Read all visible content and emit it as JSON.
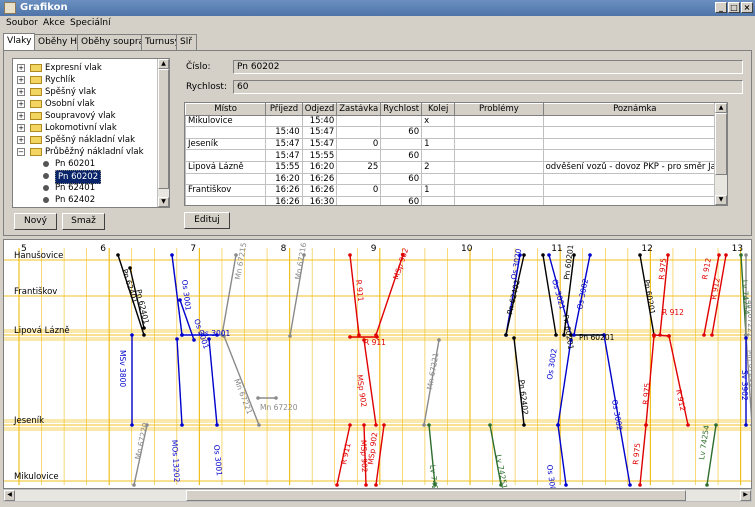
{
  "window": {
    "title": "Grafikon",
    "min": "_",
    "max": "□",
    "close": "×"
  },
  "menu": [
    "Soubor",
    "Akce",
    "Speciální"
  ],
  "tabs": [
    "Vlaky",
    "Oběhy HV",
    "Oběhy souprav",
    "Turnusy",
    "Slř"
  ],
  "tree": {
    "categories": [
      "Expresní vlak",
      "Rychlík",
      "Spěšný vlak",
      "Osobní vlak",
      "Soupravový vlak",
      "Lokomotivní vlak",
      "Spěšný nákladní vlak",
      "Průběžný nákladní vlak"
    ],
    "children": [
      "Pn 60201",
      "Pn 60202",
      "Pn 62401",
      "Pn 62402"
    ],
    "selected": "Pn 60202"
  },
  "buttons": {
    "new": "Nový",
    "delete": "Smaž",
    "edit": "Edituj"
  },
  "form": {
    "number_label": "Číslo:",
    "number_value": "Pn 60202",
    "speed_label": "Rychlost:",
    "speed_value": "60"
  },
  "table": {
    "headers": [
      "Místo",
      "Příjezd",
      "Odjezd",
      "Zastávka",
      "Rychlost",
      "Kolej",
      "Problémy",
      "Poznámka"
    ],
    "rows": [
      [
        "Mikulovice",
        "",
        "15:40",
        "",
        "",
        "x",
        "",
        ""
      ],
      [
        "",
        "15:40",
        "15:47",
        "",
        "60",
        "",
        "",
        ""
      ],
      [
        "Jeseník",
        "15:47",
        "15:47",
        "0",
        "",
        "1",
        "",
        ""
      ],
      [
        "",
        "15:47",
        "15:55",
        "",
        "60",
        "",
        "",
        ""
      ],
      [
        "Lipová Lázně",
        "15:55",
        "16:20",
        "25",
        "",
        "2",
        "",
        "odvěšení vozů - dovoz PKP - pro směr Ja..."
      ],
      [
        "",
        "16:20",
        "16:26",
        "",
        "60",
        "",
        "",
        ""
      ],
      [
        "Františkov",
        "16:26",
        "16:26",
        "0",
        "",
        "1",
        "",
        ""
      ],
      [
        "",
        "16:26",
        "16:30",
        "",
        "60",
        "",
        "",
        ""
      ]
    ]
  },
  "graph": {
    "hours": [
      "5",
      "6",
      "7",
      "8",
      "9",
      "10",
      "11",
      "12",
      "13"
    ],
    "stations": [
      "Hanušovice",
      "Františkov",
      "Lipová Lázně",
      "Jeseník",
      "Mikulovice"
    ],
    "colors": {
      "black": "#000000",
      "blue": "#0000cc",
      "gray": "#8a8a8a",
      "red": "#e00000",
      "green": "#2e6e2e",
      "grid": "#f0c020"
    },
    "trains": [
      {
        "label": "Pn 62401",
        "color": "black"
      },
      {
        "label": "Pn 62401",
        "color": "black"
      },
      {
        "label": "MSv 3800",
        "color": "blue"
      },
      {
        "label": "Os 3001",
        "color": "blue"
      },
      {
        "label": "Os 3001",
        "color": "blue"
      },
      {
        "label": "Os 3001",
        "color": "blue"
      },
      {
        "label": "MOs 13202",
        "color": "blue"
      },
      {
        "label": "Os 3001",
        "color": "blue"
      },
      {
        "label": "Mn 67220",
        "color": "gray"
      },
      {
        "label": "Mn 67215",
        "color": "gray"
      },
      {
        "label": "Mn 67221",
        "color": "gray"
      },
      {
        "label": "Mn 67220",
        "color": "gray"
      },
      {
        "label": "Mn 67216",
        "color": "gray"
      },
      {
        "label": "R 911",
        "color": "red"
      },
      {
        "label": "MSp 902",
        "color": "red"
      },
      {
        "label": "R 911",
        "color": "red"
      },
      {
        "label": "MSp 902",
        "color": "red"
      },
      {
        "label": "R 911",
        "color": "red"
      },
      {
        "label": "MSp 902",
        "color": "red"
      },
      {
        "label": "MSp 902",
        "color": "red"
      },
      {
        "label": "Mn 67221",
        "color": "gray"
      },
      {
        "label": "Lv 74252",
        "color": "green"
      },
      {
        "label": "Os 3020",
        "color": "blue"
      },
      {
        "label": "Pn 62402",
        "color": "black"
      },
      {
        "label": "Pn 62402",
        "color": "black"
      },
      {
        "label": "Lv 74251",
        "color": "green"
      },
      {
        "label": "Os 3021",
        "color": "blue"
      },
      {
        "label": "Pn 60201",
        "color": "black"
      },
      {
        "label": "Pn 60201",
        "color": "black"
      },
      {
        "label": "Os 3002",
        "color": "blue"
      },
      {
        "label": "Os 3002",
        "color": "blue"
      },
      {
        "label": "Os 3002",
        "color": "blue"
      },
      {
        "label": "Os 3002",
        "color": "blue"
      },
      {
        "label": "Pn 60201",
        "color": "black"
      },
      {
        "label": "Pn 60201",
        "color": "black"
      },
      {
        "label": "R 975",
        "color": "red"
      },
      {
        "label": "R 912",
        "color": "red"
      },
      {
        "label": "R 975",
        "color": "red"
      },
      {
        "label": "R 912",
        "color": "red"
      },
      {
        "label": "R 975",
        "color": "red"
      },
      {
        "label": "R 912",
        "color": "red"
      },
      {
        "label": "R 912",
        "color": "red"
      },
      {
        "label": "Lv 74254",
        "color": "green"
      },
      {
        "label": "Lv 74254",
        "color": "green"
      },
      {
        "label": "Mn 67222",
        "color": "gray"
      },
      {
        "label": "Mn 67211",
        "color": "gray"
      },
      {
        "label": "Sv 3902",
        "color": "blue"
      }
    ]
  }
}
